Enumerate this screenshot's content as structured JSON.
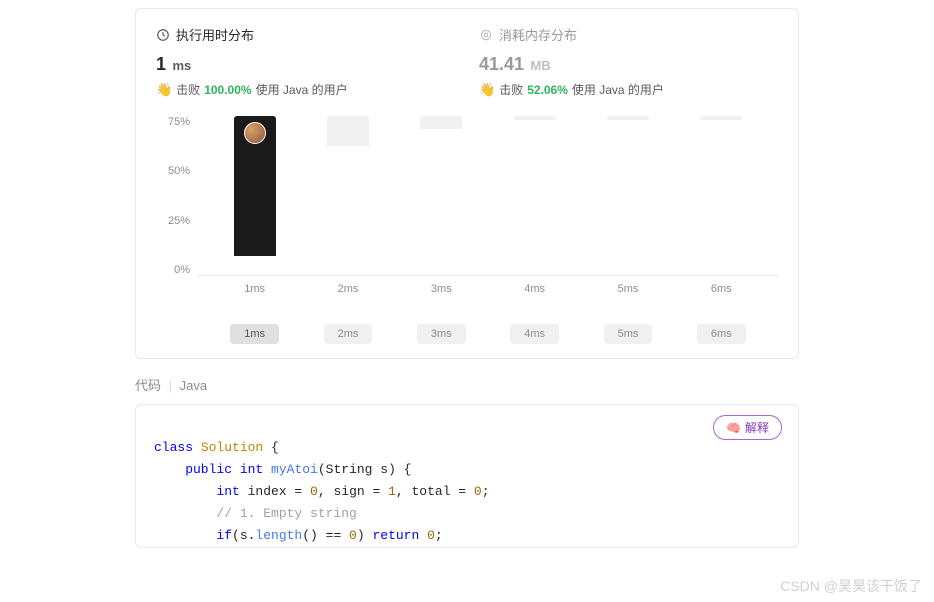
{
  "runtime": {
    "title": "执行用时分布",
    "value": "1",
    "unit": "ms",
    "beat_label": "击败",
    "beat_pct": "100.00%",
    "suffix": "使用 Java 的用户"
  },
  "memory": {
    "title": "消耗内存分布",
    "value": "41.41",
    "unit": "MB",
    "beat_label": "击败",
    "beat_pct": "52.06%",
    "suffix": "使用 Java 的用户"
  },
  "chart_data": {
    "type": "bar",
    "categories": [
      "1ms",
      "2ms",
      "3ms",
      "4ms",
      "5ms",
      "6ms"
    ],
    "values": [
      66,
      14,
      6,
      2,
      2,
      2
    ],
    "ylim": [
      0,
      75
    ],
    "yticks": [
      "75%",
      "50%",
      "25%",
      "0%"
    ],
    "xlabel": "",
    "ylabel": "",
    "title": "",
    "active_index": 0
  },
  "pills": [
    "1ms",
    "2ms",
    "3ms",
    "4ms",
    "5ms",
    "6ms"
  ],
  "section": {
    "code": "代码",
    "lang": "Java"
  },
  "explain_btn": "解释",
  "code_lines": {
    "l1a": "class ",
    "l1b": "Solution",
    "l1c": " {",
    "l2a": "    public ",
    "l2b": "int ",
    "l2c": "myAtoi",
    "l2d": "(String s) {",
    "l3a": "        int ",
    "l3b": "index = ",
    "l3c": "0",
    "l3d": ", sign = ",
    "l3e": "1",
    "l3f": ", total = ",
    "l3g": "0",
    "l3h": ";",
    "l4": "        // 1. Empty string",
    "l5a": "        if",
    "l5b": "(s.",
    "l5c": "length",
    "l5d": "() == ",
    "l5e": "0",
    "l5f": ") ",
    "l5g": "return ",
    "l5h": "0",
    "l5i": ";"
  },
  "watermark": "CSDN @昊昊该干饭了"
}
